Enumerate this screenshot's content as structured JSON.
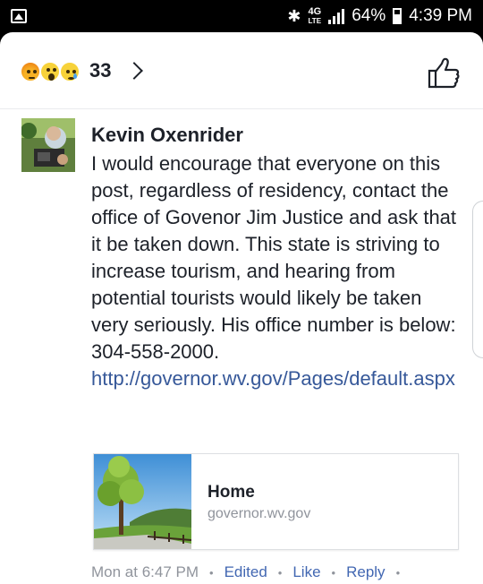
{
  "status_bar": {
    "network": "4G",
    "network_sub": "LTE",
    "battery": "64%",
    "time": "4:39 PM",
    "icons": [
      "gallery-icon",
      "bluetooth-icon",
      "signal-icon",
      "battery-icon"
    ]
  },
  "reactions": {
    "types": [
      "angry",
      "wow",
      "sad"
    ],
    "count": "33"
  },
  "comment": {
    "author": "Kevin Oxenrider",
    "text": "I would encourage that everyone on this post, regardless of residency, contact the office of Govenor Jim Justice and ask that it be taken down. This state is striving to increase tourism, and hearing from potential tourists would likely be taken very seriously. His office number is below: 304-558-2000.",
    "link": "http://governor.wv.gov/Pages/default.aspx"
  },
  "link_preview": {
    "title": "Home",
    "domain": "governor.wv.gov"
  },
  "meta": {
    "timestamp": "Mon at 6:47 PM",
    "edited": "Edited",
    "like": "Like",
    "reply": "Reply",
    "separator": "•"
  },
  "colors": {
    "link": "#365899",
    "action": "#4267b2",
    "muted": "#90949c",
    "text": "#1d2129"
  }
}
